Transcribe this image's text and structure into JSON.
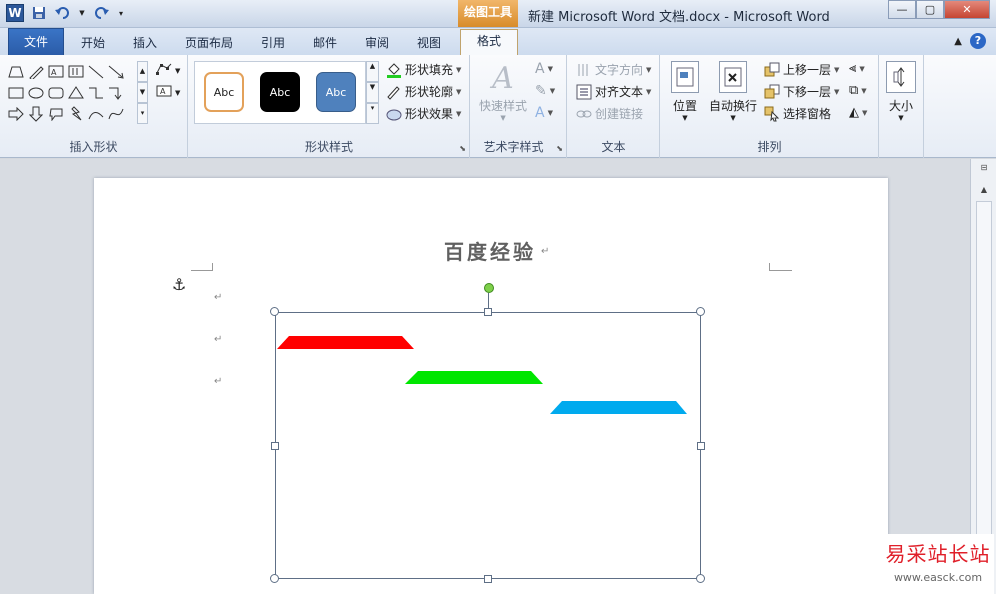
{
  "window": {
    "title": "新建 Microsoft Word 文档.docx  -  Microsoft Word",
    "context_tab_header": "绘图工具",
    "controls": {
      "minimize": "—",
      "maximize": "▢",
      "close": "✕"
    }
  },
  "quick_access": {
    "app_icon": "W"
  },
  "tabs": {
    "file": "文件",
    "home": "开始",
    "insert": "插入",
    "layout": "页面布局",
    "references": "引用",
    "mailings": "邮件",
    "review": "审阅",
    "view": "视图",
    "format": "格式"
  },
  "ribbon": {
    "insert_shapes": {
      "label": "插入形状"
    },
    "shape_styles": {
      "label": "形状样式",
      "gallery": [
        {
          "text": "Abc",
          "style": "outline-orange"
        },
        {
          "text": "Abc",
          "style": "fill-black"
        },
        {
          "text": "Abc",
          "style": "fill-blue"
        }
      ],
      "fill": "形状填充",
      "outline": "形状轮廓",
      "effects": "形状效果"
    },
    "wordart": {
      "label": "艺术字样式",
      "quick_styles": "快速样式"
    },
    "text": {
      "label": "文本",
      "direction": "文字方向",
      "align": "对齐文本",
      "link": "创建链接"
    },
    "arrange": {
      "label": "排列",
      "position": "位置",
      "wrap": "自动换行",
      "forward": "上移一层",
      "backward": "下移一层",
      "pane": "选择窗格"
    },
    "size": {
      "label": "大小"
    }
  },
  "document": {
    "heading": "百度经验",
    "para_mark": "↵",
    "shapes": [
      {
        "color": "#ff0000"
      },
      {
        "color": "#00e600"
      },
      {
        "color": "#00aaee"
      }
    ]
  },
  "watermark": {
    "line1": "易采站长站",
    "line2": "www.easck.com"
  },
  "colors": {
    "accent": "#2b579a",
    "context_tab": "#d88c2a",
    "selection": "#5e6f86"
  }
}
